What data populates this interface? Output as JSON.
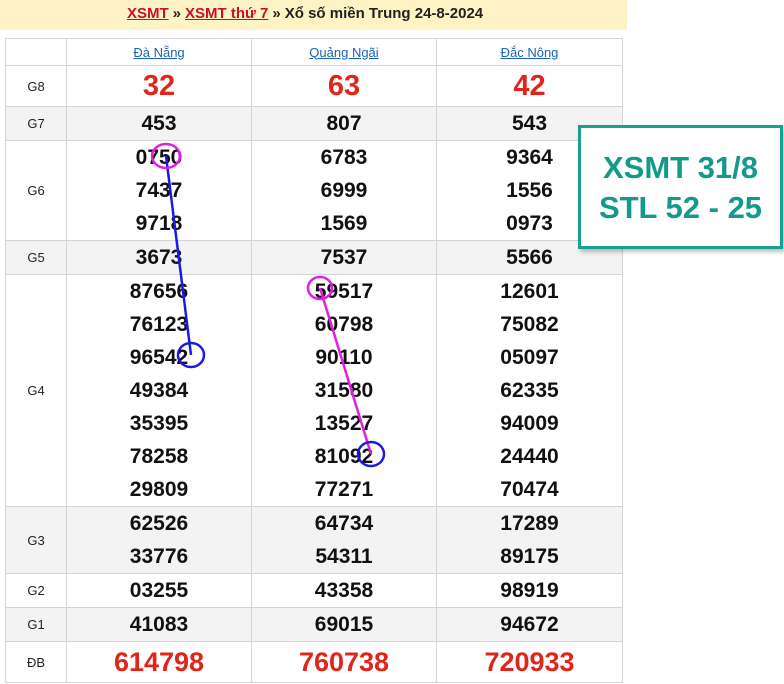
{
  "breadcrumb": {
    "link1": "XSMT",
    "sep": "»",
    "link2": "XSMT thứ 7",
    "tail": "Xổ số miền Trung 24-8-2024"
  },
  "provinces": [
    "Đà Nẵng",
    "Quảng Ngãi",
    "Đắc Nông"
  ],
  "rows": [
    {
      "prize": "G8",
      "style": "big",
      "values": [
        [
          "32"
        ],
        [
          "63"
        ],
        [
          "42"
        ]
      ]
    },
    {
      "prize": "G7",
      "style": "num",
      "values": [
        [
          "453"
        ],
        [
          "807"
        ],
        [
          "543"
        ]
      ]
    },
    {
      "prize": "G6",
      "style": "num",
      "values": [
        [
          "0750",
          "7437",
          "9718"
        ],
        [
          "6783",
          "6999",
          "1569"
        ],
        [
          "9364",
          "1556",
          "0973"
        ]
      ]
    },
    {
      "prize": "G5",
      "style": "num",
      "values": [
        [
          "3673"
        ],
        [
          "7537"
        ],
        [
          "5566"
        ]
      ]
    },
    {
      "prize": "G4",
      "style": "num",
      "values": [
        [
          "87656",
          "76123",
          "96542",
          "49384",
          "35395",
          "78258",
          "29809"
        ],
        [
          "59517",
          "60798",
          "90110",
          "31580",
          "13527",
          "81092",
          "77271"
        ],
        [
          "12601",
          "75082",
          "05097",
          "62335",
          "94009",
          "24440",
          "70474"
        ]
      ]
    },
    {
      "prize": "G3",
      "style": "num",
      "values": [
        [
          "62526",
          "33776"
        ],
        [
          "64734",
          "54311"
        ],
        [
          "17289",
          "89175"
        ]
      ]
    },
    {
      "prize": "G2",
      "style": "num",
      "values": [
        [
          "03255"
        ],
        [
          "43358"
        ],
        [
          "98919"
        ]
      ]
    },
    {
      "prize": "G1",
      "style": "num",
      "values": [
        [
          "41083"
        ],
        [
          "69015"
        ],
        [
          "94672"
        ]
      ]
    },
    {
      "prize": "ĐB",
      "style": "db",
      "values": [
        [
          "614798"
        ],
        [
          "760738"
        ],
        [
          "720933"
        ]
      ]
    }
  ],
  "note": {
    "line1": "XSMT 31/8",
    "line2": "STL 52 - 25"
  },
  "colors": {
    "accent_red": "#e1251b",
    "teal": "#139a8a",
    "header_bg": "#fdf3c4",
    "link_blue": "#1a63b8",
    "circle_magenta": "#e020e0",
    "circle_blue": "#1a1ae0"
  }
}
